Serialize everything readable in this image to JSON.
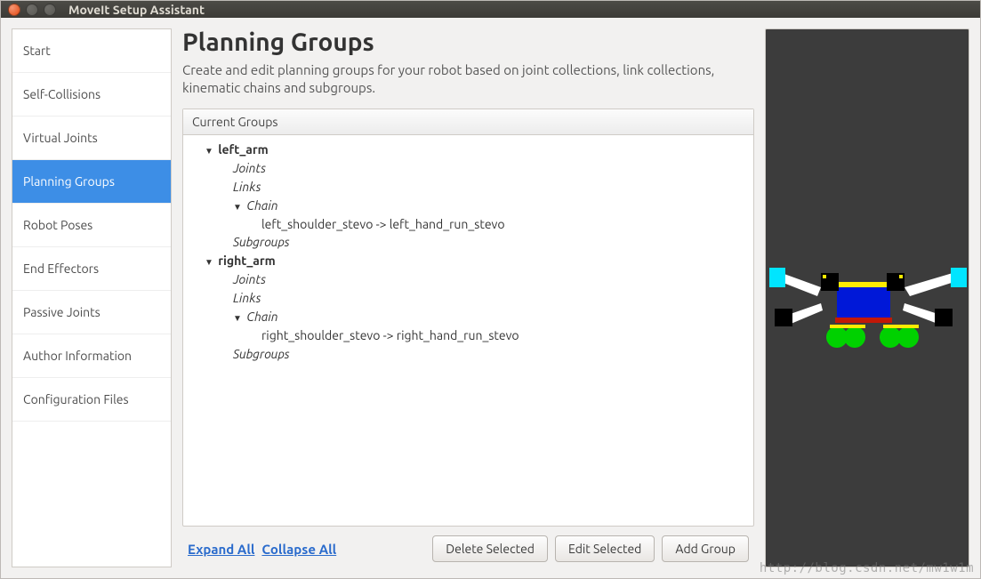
{
  "window": {
    "title": "MoveIt Setup Assistant"
  },
  "sidebar": {
    "items": [
      {
        "label": "Start",
        "active": false
      },
      {
        "label": "Self-Collisions",
        "active": false
      },
      {
        "label": "Virtual Joints",
        "active": false
      },
      {
        "label": "Planning Groups",
        "active": true
      },
      {
        "label": "Robot Poses",
        "active": false
      },
      {
        "label": "End Effectors",
        "active": false
      },
      {
        "label": "Passive Joints",
        "active": false
      },
      {
        "label": "Author Information",
        "active": false
      },
      {
        "label": "Configuration Files",
        "active": false
      }
    ]
  },
  "page": {
    "title": "Planning Groups",
    "description": "Create and edit planning groups for your robot based on joint collections, link collections, kinematic chains and subgroups."
  },
  "groups_panel": {
    "header": "Current Groups",
    "tree": [
      {
        "label": "left_arm",
        "depth": 1,
        "expanded": true,
        "bold": true
      },
      {
        "label": "Joints",
        "depth": 2,
        "italic": true
      },
      {
        "label": "Links",
        "depth": 2,
        "italic": true
      },
      {
        "label": "Chain",
        "depth": 3,
        "expanded": true,
        "italic": true
      },
      {
        "label": "left_shoulder_stevo -> left_hand_run_stevo",
        "depth": 4
      },
      {
        "label": "Subgroups",
        "depth": 2,
        "italic": true
      },
      {
        "label": "right_arm",
        "depth": 1,
        "expanded": true,
        "bold": true
      },
      {
        "label": "Joints",
        "depth": 2,
        "italic": true
      },
      {
        "label": "Links",
        "depth": 2,
        "italic": true
      },
      {
        "label": "Chain",
        "depth": 3,
        "expanded": true,
        "italic": true
      },
      {
        "label": "right_shoulder_stevo -> right_hand_run_stevo",
        "depth": 4
      },
      {
        "label": "Subgroups",
        "depth": 2,
        "italic": true
      }
    ]
  },
  "actions": {
    "expand_all": "Expand All",
    "collapse_all": "Collapse All",
    "delete_selected": "Delete Selected",
    "edit_selected": "Edit Selected",
    "add_group": "Add Group"
  },
  "watermark": "http://blog.csdn.net/mw1w1m"
}
